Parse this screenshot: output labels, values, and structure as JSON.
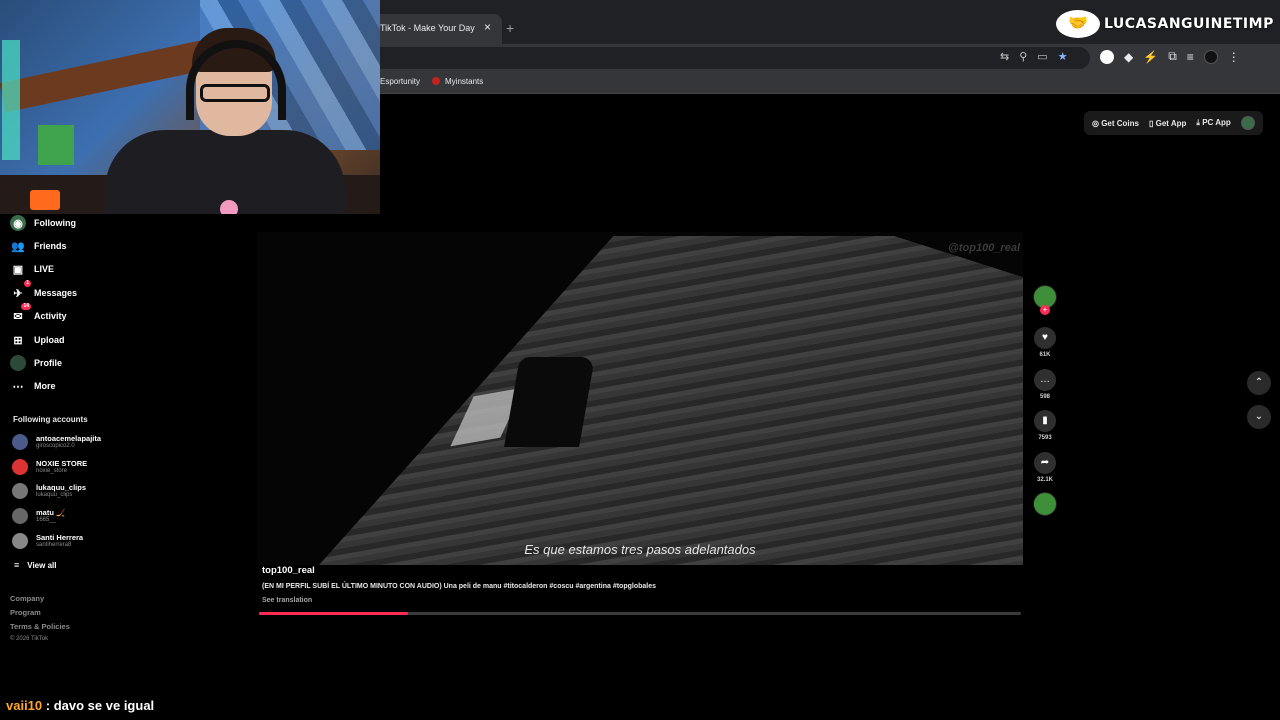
{
  "browser": {
    "tab_title": "TikTok - Make Your Day",
    "tab_close": "×",
    "new_tab": "+",
    "bookmarks": [
      "Esportunity",
      "Myinstants"
    ]
  },
  "overlay": {
    "logo_text": "LUCASANGUINETIMP",
    "chat_user": "vaii10",
    "chat_message": ": davo se ve igual"
  },
  "tiktok": {
    "top_actions": [
      "Get Coins",
      "Get App",
      "PC App"
    ],
    "sidebar": [
      {
        "label": "Following",
        "icon": "following-icon"
      },
      {
        "label": "Friends",
        "icon": "friends-icon"
      },
      {
        "label": "LIVE",
        "icon": "live-icon"
      },
      {
        "label": "Messages",
        "icon": "messages-icon",
        "badge": "1"
      },
      {
        "label": "Activity",
        "icon": "activity-icon",
        "badge": "14"
      },
      {
        "label": "Upload",
        "icon": "upload-icon"
      },
      {
        "label": "Profile",
        "icon": "profile-icon"
      },
      {
        "label": "More",
        "icon": "more-icon"
      }
    ],
    "following_heading": "Following accounts",
    "following_accounts": [
      {
        "name": "antoacemelapajita",
        "handle": "giroscopico2.0"
      },
      {
        "name": "NOXIE STORE",
        "handle": "noxie_store"
      },
      {
        "name": "lukaquu_clips",
        "handle": "lukaquu_clips"
      },
      {
        "name": "matu 🏒",
        "handle": "1665__"
      },
      {
        "name": "Santi Herrera",
        "handle": "santiherrera8"
      }
    ],
    "view_all": "View all",
    "footer_links": [
      "Company",
      "Program",
      "Terms & Policies"
    ],
    "copyright": "© 2026 TikTok",
    "video": {
      "watermark": "@top100_real",
      "subtitle": "Es que estamos tres pasos adelantados",
      "author": "top100_real",
      "description": "(EN MI PERFIL SUBÍ EL ÚLTIMO MINUTO CON AUDIO) Una peli de manu #titocalderon #coscu #argentina #topglobales",
      "see_translation": "See translation",
      "progress": 0.195
    },
    "actions": {
      "likes": "61K",
      "comments": "598",
      "saves": "7593",
      "shares": "32.1K"
    }
  }
}
